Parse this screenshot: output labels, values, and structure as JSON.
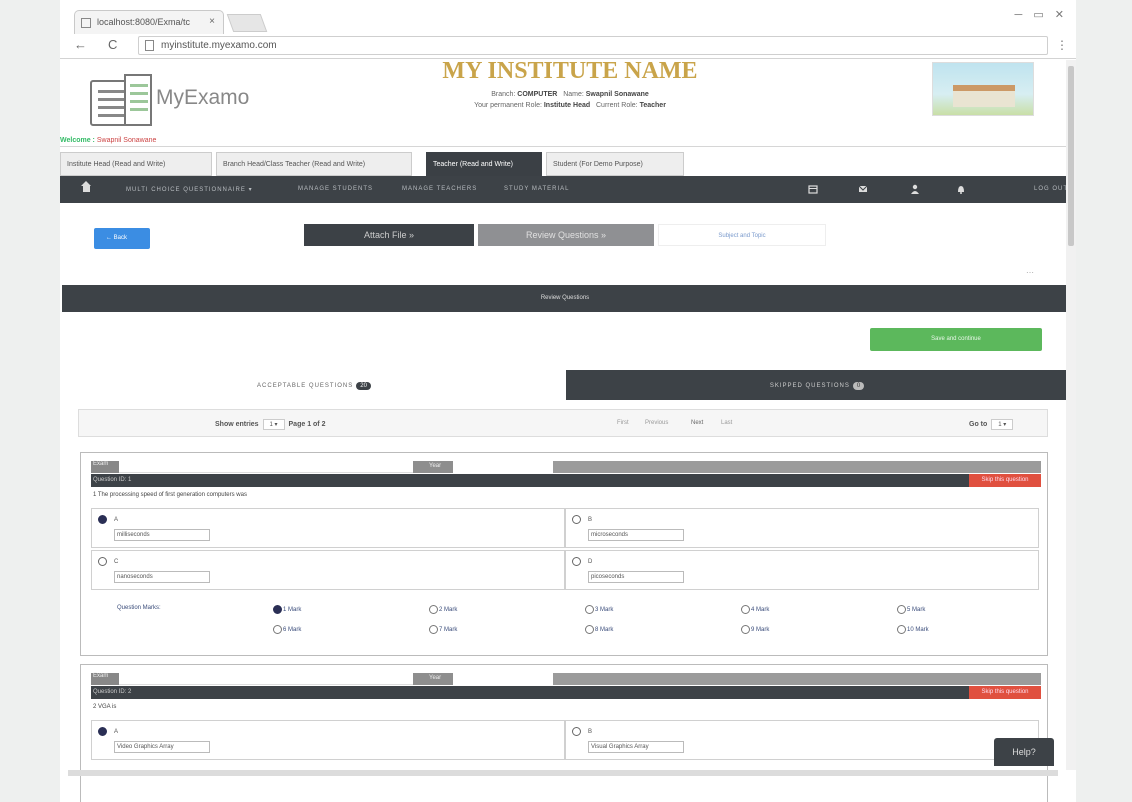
{
  "browser": {
    "tab_title": "localhost:8080/Exma/tc",
    "tab_close": "×",
    "url": "myinstitute.myexamo.com",
    "back": "←",
    "reload": "C",
    "menu": "⋮",
    "window_controls": "─ ▭ ✕"
  },
  "header": {
    "brand": "MyExamo",
    "institute_name": "MY INSTITUTE NAME",
    "branch_label": "Branch:",
    "branch": "COMPUTER",
    "name_label": "Name:",
    "user_name": "Swapnil Sonawane",
    "perm_role_label": "Your permanent Role:",
    "perm_role": "Institute Head",
    "current_role_label": "Current Role:",
    "current_role": "Teacher",
    "welcome_label": "Welcome :",
    "welcome_user": "Swapnil Sonawane"
  },
  "roles": [
    "Institute Head (Read and Write)",
    "Branch Head/Class Teacher (Read and Write)",
    "Teacher (Read and Write)",
    "Student (For Demo Purpose)"
  ],
  "navbar": {
    "links": [
      "MULTI CHOICE QUESTIONNAIRE ▾",
      "MANAGE STUDENTS",
      "MANAGE TEACHERS",
      "STUDY MATERIAL"
    ],
    "logout": "LOG OUT"
  },
  "actions": {
    "back": "Back",
    "attach": "Attach File »",
    "review": "Review Questions »",
    "subject": "Subject and Topic",
    "dots": "⋯",
    "review_title": "Review Questions",
    "save": "Save and continue"
  },
  "question_tabs": {
    "acceptable_label": "ACCEPTABLE QUESTIONS",
    "acceptable_count": "20",
    "skipped_label": "SKIPPED QUESTIONS",
    "skipped_count": "0"
  },
  "pager": {
    "show_entries": "Show entries",
    "entries_value": "1",
    "page_info": "Page 1 of 2",
    "first": "First",
    "previous": "Previous",
    "next": "Next",
    "last": "Last",
    "goto_label": "Go to",
    "goto_value": "1"
  },
  "questions": [
    {
      "exam": "Exam",
      "year": "Year",
      "id_label": "Question ID: 1",
      "skip": "Skip this question",
      "text": "1 The processing speed of first generation computers was",
      "options": [
        {
          "letter": "A",
          "value": "milliseconds",
          "selected": true
        },
        {
          "letter": "B",
          "value": "microseconds",
          "selected": false
        },
        {
          "letter": "C",
          "value": "nanoseconds",
          "selected": false
        },
        {
          "letter": "D",
          "value": "picoseconds",
          "selected": false
        }
      ],
      "marks_label": "Question Marks:",
      "marks": [
        "1 Mark",
        "2 Mark",
        "3 Mark",
        "4 Mark",
        "5 Mark",
        "6 Mark",
        "7 Mark",
        "8 Mark",
        "9 Mark",
        "10 Mark"
      ],
      "marks_selected": 0
    },
    {
      "exam": "Exam",
      "year": "Year",
      "id_label": "Question ID: 2",
      "skip": "Skip this question",
      "text": "2 VGA is",
      "options": [
        {
          "letter": "A",
          "value": "Video Graphics Array",
          "selected": true
        },
        {
          "letter": "B",
          "value": "Visual Graphics Array",
          "selected": false
        }
      ]
    }
  ],
  "help": "Help?"
}
